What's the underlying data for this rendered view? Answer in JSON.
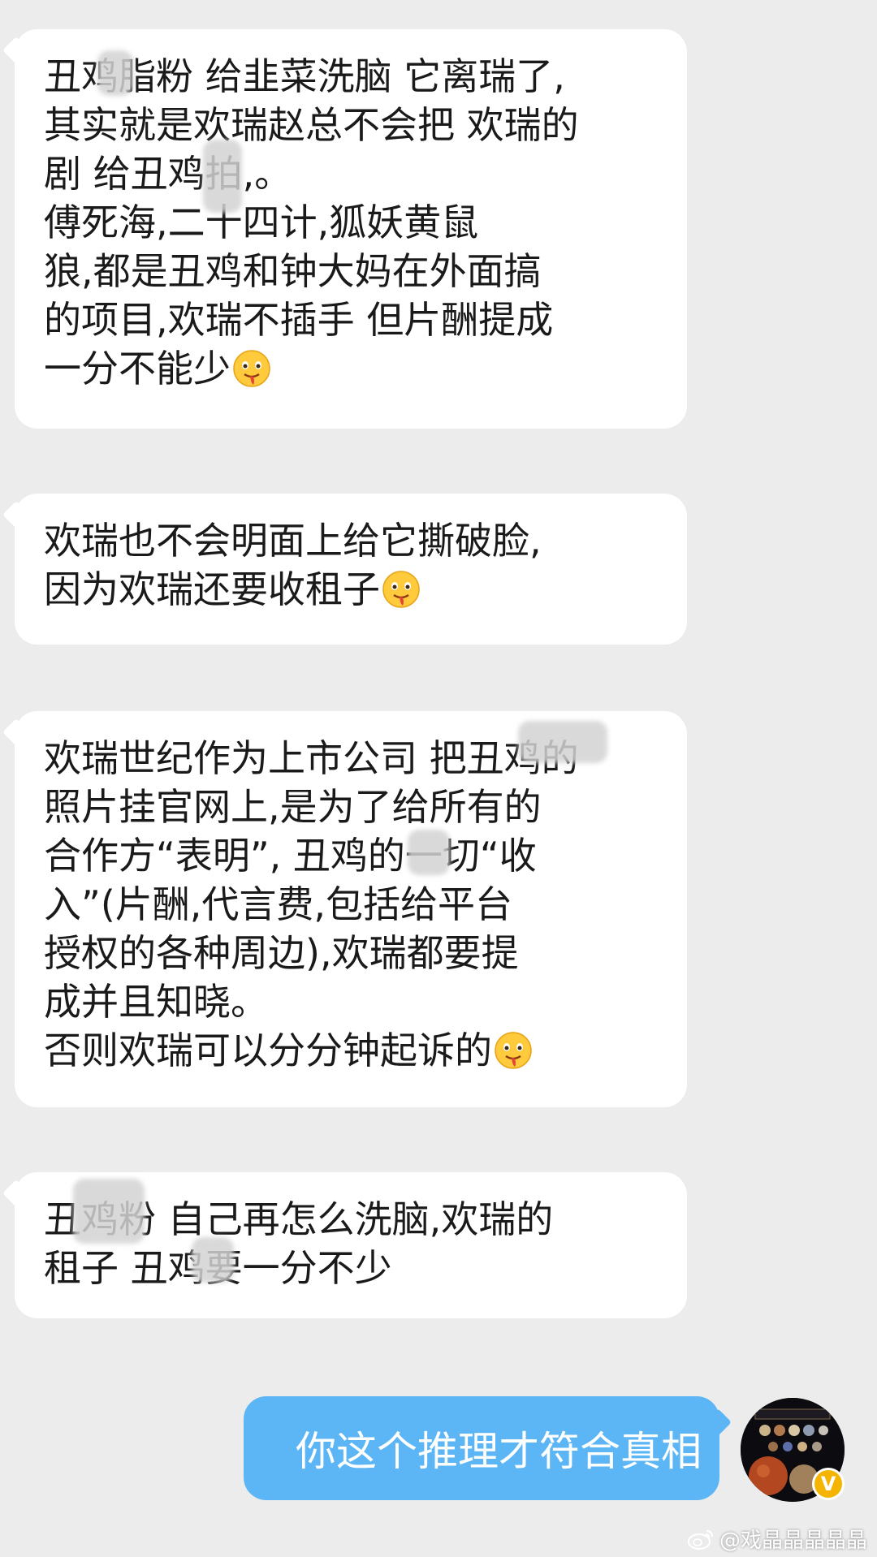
{
  "messages": [
    {
      "sender": "other",
      "lines": [
        "丑鸡脂粉 给韭菜洗脑 它离瑞了,",
        "其实就是欢瑞赵总不会把 欢瑞的",
        "剧 给丑鸡拍,。",
        "傅死海,二十四计,狐妖黄鼠",
        "狼,都是丑鸡和钟大妈在外面搞",
        "的项目,欢瑞不插手 但片酬提成",
        "一分不能少"
      ],
      "emoji_after_last": "drooling-face"
    },
    {
      "sender": "other",
      "lines": [
        "欢瑞也不会明面上给它撕破脸,",
        "因为欢瑞还要收租子"
      ],
      "emoji_after_last": "drooling-face"
    },
    {
      "sender": "other",
      "lines": [
        "欢瑞世纪作为上市公司 把丑鸡的",
        "照片挂官网上,是为了给所有的",
        "合作方“表明”, 丑鸡的一切“收",
        "入”(片酬,代言费,包括给平台",
        "授权的各种周边),欢瑞都要提",
        "成并且知晓。",
        "否则欢瑞可以分分钟起诉的"
      ],
      "emoji_after_last": "drooling-face"
    },
    {
      "sender": "other",
      "lines": [
        "丑鸡粉 自己再怎么洗脑,欢瑞的",
        "租子 丑鸡要一分不少"
      ],
      "emoji_after_last": ""
    }
  ],
  "my_message": {
    "text": "你这个推理才符合真相"
  },
  "avatar": {
    "icon": "planets-avatar-icon",
    "badge_text": "V",
    "badge_color": "#f4b400"
  },
  "watermark": {
    "text": "@戏晶晶晶晶晶",
    "icon": "weibo-logo-icon"
  },
  "colors": {
    "background": "#ececec",
    "other_bubble": "#ffffff",
    "my_bubble": "#5cb6f5"
  }
}
